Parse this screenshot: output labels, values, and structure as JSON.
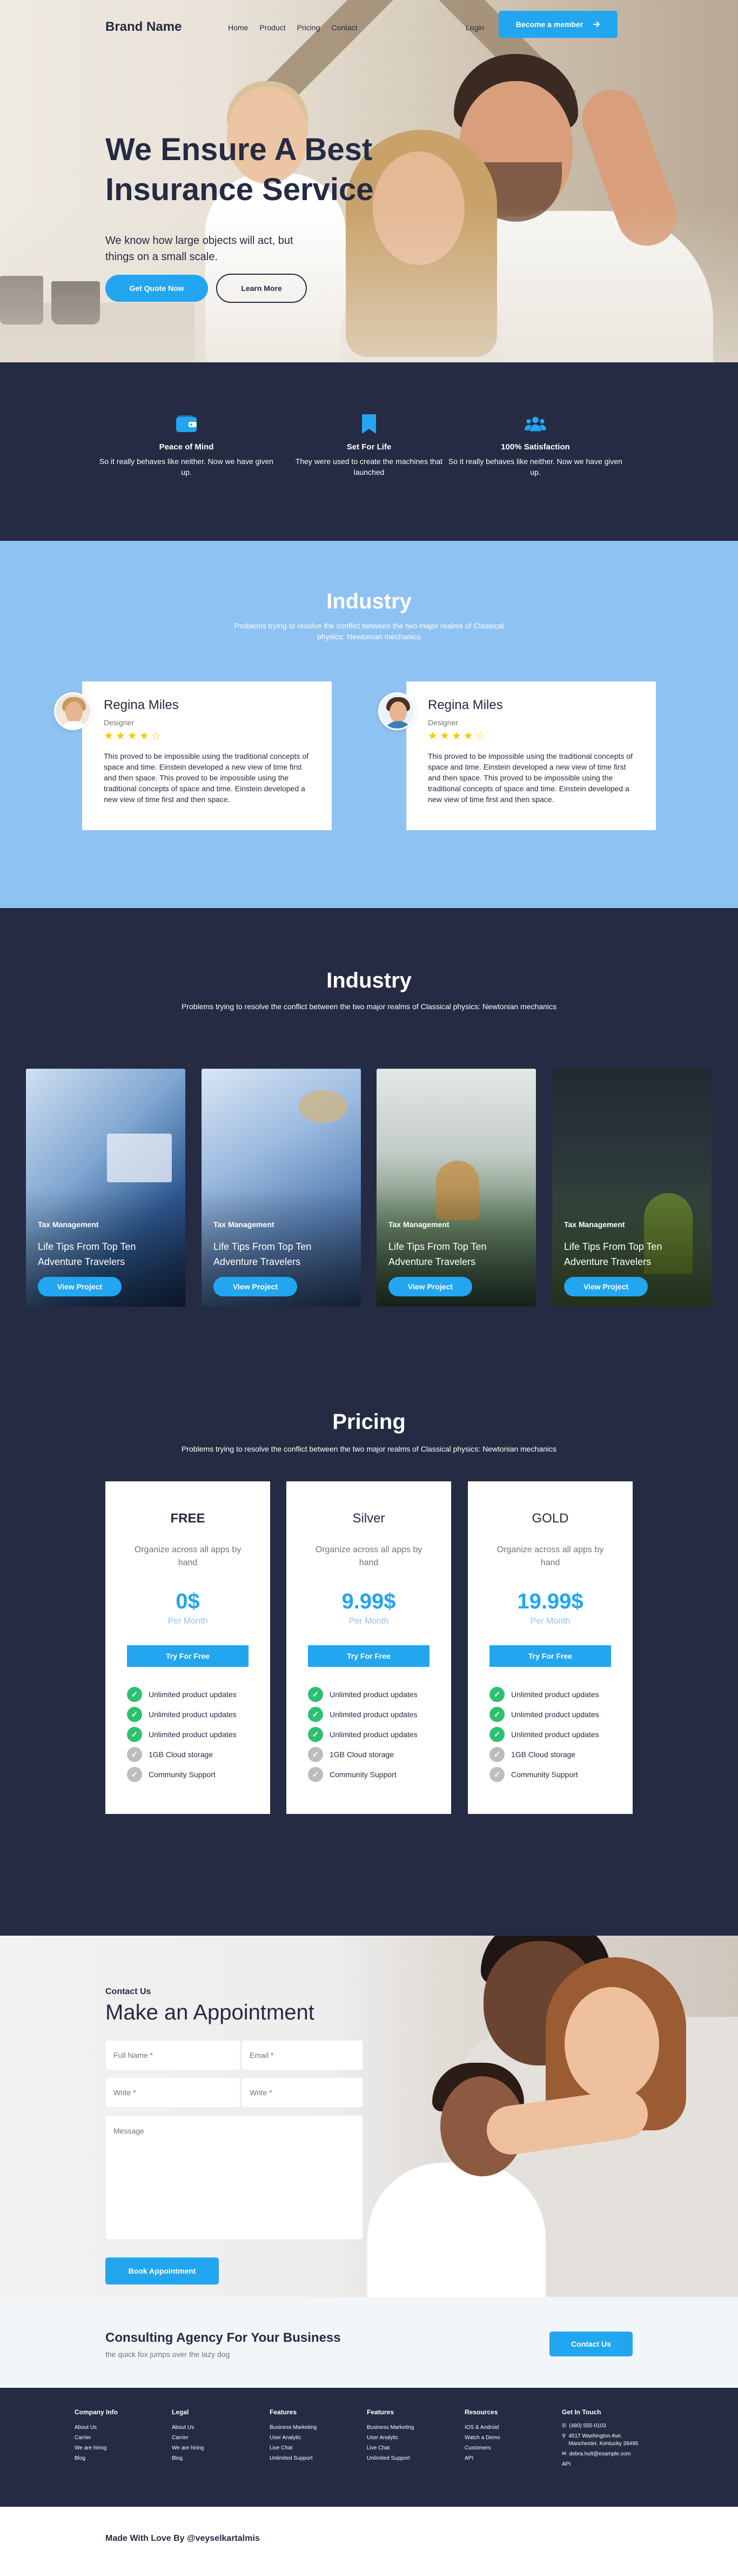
{
  "nav": {
    "brand": "Brand Name",
    "links": [
      "Home",
      "Product",
      "Pricing",
      "Contact"
    ],
    "login": "Login",
    "member_button": "Become a member",
    "arrow_icon": "arrow-right-icon"
  },
  "hero": {
    "title": "We Ensure A Best Insurance Service",
    "subtitle": "We know how large objects will act, but things on a small scale.",
    "quote_button": "Get Quote Now",
    "learn_button": "Learn More"
  },
  "features": [
    {
      "icon": "wallet-icon",
      "title": "Peace of Mind",
      "text": "So it really behaves like neither. Now we have given up."
    },
    {
      "icon": "bookmark-icon",
      "title": "Set For Life",
      "text": "They were used to create the machines that launched"
    },
    {
      "icon": "users-icon",
      "title": "100% Satisfaction",
      "text": "So it really behaves like neither. Now we have given up."
    }
  ],
  "testimonials": {
    "title": "Industry",
    "subtitle": "Problems trying to resolve the conflict between the two major realms of Classical physics: Newtonian mechanics",
    "cards": [
      {
        "name": "Regina Miles",
        "role": "Designer",
        "rating": 4,
        "max_rating": 5,
        "text": "This proved to be impossible using the traditional concepts of space and time. Einstein developed a new view of time first and then space. This proved to be impossible using the traditional concepts of space and time. Einstein developed a new view of time first and then space."
      },
      {
        "name": "Regina Miles",
        "role": "Designer",
        "rating": 4,
        "max_rating": 5,
        "text": "This proved to be impossible using the traditional concepts of space and time. Einstein developed a new view of time first and then space. This proved to be impossible using the traditional concepts of space and time. Einstein developed a new view of time first and then space."
      }
    ]
  },
  "projects": {
    "title": "Industry",
    "subtitle": "Problems trying to resolve the conflict between the two major realms of Classical physics: Newtonian mechanics",
    "cards": [
      {
        "tag": "Tax Management",
        "title": "Life Tips From Top Ten Adventure Travelers",
        "button": "View Project"
      },
      {
        "tag": "Tax Management",
        "title": "Life Tips From Top Ten Adventure Travelers",
        "button": "View Project"
      },
      {
        "tag": "Tax Management",
        "title": "Life Tips From Top Ten Adventure Travelers",
        "button": "View Project"
      },
      {
        "tag": "Tax Management",
        "title": "Life Tips From Top Ten Adventure Travelers",
        "button": "View Project"
      }
    ]
  },
  "pricing": {
    "title": "Pricing",
    "subtitle": "Problems trying to resolve the conflict between the two major realms of Classical physics: Newtonian mechanics",
    "plans": [
      {
        "name": "FREE",
        "desc": "Organize across all apps by hand",
        "price": "0$",
        "period": "Per Month",
        "button": "Try For Free"
      },
      {
        "name": "Silver",
        "desc": "Organize across all apps by hand",
        "price": "9.99$",
        "period": "Per Month",
        "button": "Try For Free"
      },
      {
        "name": "GOLD",
        "desc": "Organize across all apps by hand",
        "price": "19.99$",
        "period": "Per Month",
        "button": "Try For Free"
      }
    ],
    "features": [
      {
        "label": "Unlimited product updates",
        "included": true
      },
      {
        "label": "Unlimited product updates",
        "included": true
      },
      {
        "label": "Unlimited product updates",
        "included": true
      },
      {
        "label": "1GB Cloud storage",
        "included": false
      },
      {
        "label": "Community Support",
        "included": false
      }
    ]
  },
  "appointment": {
    "label": "Contact Us",
    "title": "Make an Appointment",
    "full_name_placeholder": "Full Name *",
    "email_placeholder": "Email *",
    "write1_placeholder": "Write *",
    "write2_placeholder": "Write *",
    "message_placeholder": "Message",
    "button": "Book Appointment"
  },
  "cta": {
    "title": "Consulting Agency For Your Business",
    "subtitle": "the quick fox jumps over the lazy dog",
    "button": "Contact Us"
  },
  "footer": {
    "columns": [
      {
        "title": "Company Info",
        "links": [
          "About Us",
          "Carrier",
          "We are hiring",
          "Blog"
        ]
      },
      {
        "title": "Legal",
        "links": [
          "About Us",
          "Carrier",
          "We are hiring",
          "Blog"
        ]
      },
      {
        "title": "Features",
        "links": [
          "Business Marketing",
          "User Analytic",
          "Live Chat",
          "Unlimited Support"
        ]
      },
      {
        "title": "Features",
        "links": [
          "Business Marketing",
          "User Analytic",
          "Live Chat",
          "Unlimited Support"
        ]
      },
      {
        "title": "Resources",
        "links": [
          "IOS & Android",
          "Watch a Demo",
          "Customers",
          "API"
        ]
      }
    ],
    "contact": {
      "title": "Get In Touch",
      "phone": "(480) 555-0103",
      "address": "4517 Washington Ave. Manchester, Kentucky 39495",
      "email": "debra.holt@example.com",
      "extra": "API"
    },
    "made_by": "Made With Love By @veyselkartalmis"
  },
  "colors": {
    "primary": "#23a6f0",
    "dark": "#252b42",
    "light_blue": "#8ec2f2",
    "success": "#2dc071",
    "star": "#f3cd03"
  }
}
